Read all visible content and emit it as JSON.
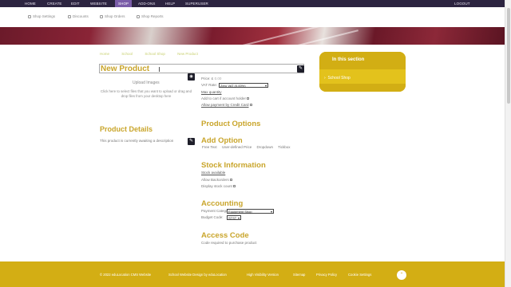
{
  "topnav": {
    "items": [
      "HOME",
      "CREATE",
      "EDIT",
      "WEBSITE",
      "SHOP",
      "ADD-ONS",
      "HELP",
      "SUPERUSER"
    ],
    "active": "SHOP",
    "logout": "LOGOUT"
  },
  "subnav": {
    "items": [
      "Shop Settings",
      "Discounts",
      "Shop Orders",
      "Shop Reports"
    ]
  },
  "breadcrumb": [
    "Home",
    "School",
    "School Shop",
    "New Product"
  ],
  "product": {
    "title": "New Product",
    "upload_title": "Upload Images",
    "upload_text": "Click here to select files that you want to upload or drag and drop files from your desktop here",
    "details_heading": "Product Details",
    "details_text": "This product is currently awaiting a description"
  },
  "pricing": {
    "price_label": "Price:",
    "price_currency": "£",
    "price_value": "0.00",
    "vat_label": "VAT Rate:",
    "vat_value": "Zero VAT (0.00%)",
    "max_quantity": "Max quantity",
    "add_to_cart": "Add to cart if account holder",
    "allow_payment": "Allow payment by Credit Card"
  },
  "options": {
    "heading": "Product Options",
    "add_option_heading": "Add Option",
    "option_types": [
      "Free Text",
      "User-defined Price",
      "Dropdown",
      "Tickbox"
    ]
  },
  "stock": {
    "heading": "Stock Information",
    "stock_available": "Stock available",
    "allow_backorders": "Allow Backorders",
    "display_stock_count": "Display stock count"
  },
  "accounting": {
    "heading": "Accounting",
    "payment_category_label": "Payment Category:",
    "payment_category_value": "Equipment Shop",
    "budget_code_label": "Budget Code:",
    "budget_code_value": "STST"
  },
  "access": {
    "heading": "Access Code",
    "text": "Code required to purchase product"
  },
  "sidebar": {
    "heading": "In this section",
    "items": [
      "School Shop"
    ]
  },
  "footer": {
    "items": [
      "© 2022 eduLocation CMS Website",
      "School Website Design by eduLocation",
      "High Visibility Version",
      "Sitemap",
      "Privacy Policy",
      "Cookie Settings"
    ]
  },
  "colors": {
    "brand_gold": "#c9a52b",
    "footer_gold": "#d3ae14",
    "nav_dark": "#2c2440",
    "nav_active": "#7a5ca8"
  }
}
